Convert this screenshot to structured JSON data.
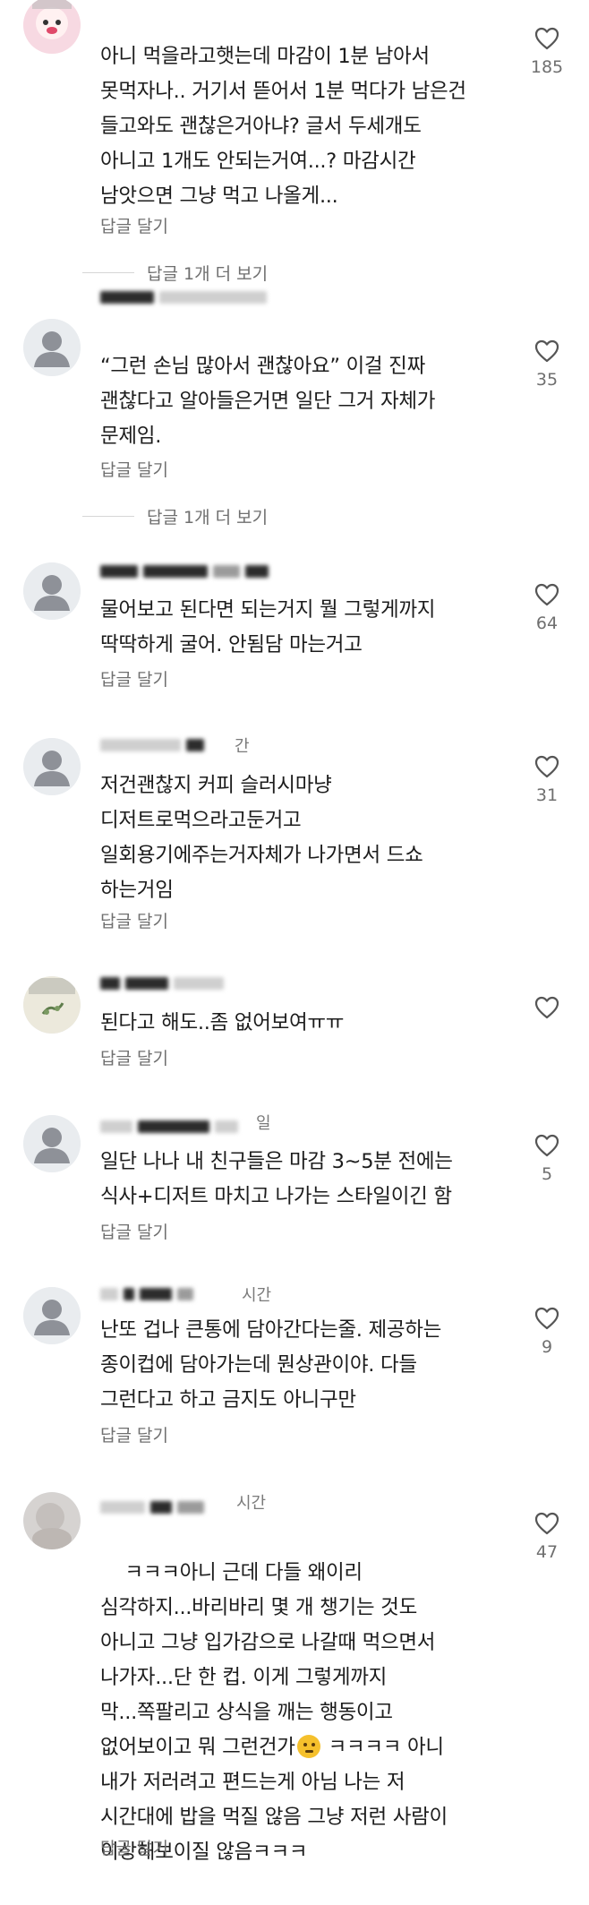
{
  "comments": [
    {
      "text": "아니 먹을라고햇는데 마감이 1분 남아서\n못먹자나.. 거기서 뜯어서 1분 먹다가 남은건\n들고와도 괜찮은거아냐? 글서 두세개도\n아니고 1개도 안되는거여...? 마감시간\n남앗으면 그냥 먹고 나올게...",
      "reply_label": "답글 달기",
      "likes": "185",
      "more_replies": "답글 1개 더 보기"
    },
    {
      "text": "“그런 손님 많아서 괜찮아요” 이걸 진짜\n괜찮다고 알아들은거면 일단 그거 자체가\n문제임.",
      "reply_label": "답글 달기",
      "likes": "35",
      "more_replies": "답글 1개 더 보기"
    },
    {
      "text": "물어보고 된다면 되는거지 뭘 그렇게까지\n딱딱하게 굴어. 안됨담 마는거고",
      "reply_label": "답글 달기",
      "likes": "64"
    },
    {
      "username_suffix": "간",
      "text": "저건괜찮지 커피 슬러시마냥\n디저트로먹으라고둔거고\n일회용기에주는거자체가 나가면서 드쇼\n하는거임",
      "reply_label": "답글 달기",
      "likes": "31"
    },
    {
      "text": "된다고 해도..좀 없어보여ㅠㅠ",
      "reply_label": "답글 달기",
      "likes": ""
    },
    {
      "username_suffix": "일",
      "text": "일단 나나 내 친구들은 마감 3~5분 전에는\n식사+디저트 마치고 나가는 스타일이긴 함",
      "reply_label": "답글 달기",
      "likes": "5"
    },
    {
      "username_suffix": "시간",
      "text": "난또 겁나 큰통에 담아간다는줄. 제공하는\n종이컵에 담아가는데 뭔상관이야. 다들\n그런다고 하고 금지도 아니구만",
      "reply_label": "답글 달기",
      "likes": "9"
    },
    {
      "username_suffix": "시간",
      "text_before_emoji": "ㅋㅋㅋ아니 근데 다들 왜이리\n심각하지...바리바리 몇 개 챙기는 것도\n아니고 그냥 입가감으로 나갈때 먹으면서\n나가자...단 한 컵. 이게 그렇게까지\n막...쪽팔리고 상식을 깨는 행동이고\n없어보이고 뭐 그런건가",
      "text_after_emoji": " ㅋㅋㅋㅋ 아니\n내가 저러려고 편드는게 아님 나는 저\n시간대에 밥을 먹질 않음 그냥 저런 사람이\n이상해보이질 않음ㅋㅋㅋ",
      "emoji": "thinking-face-emoji",
      "reply_label": "답글 달기",
      "likes": "47"
    }
  ],
  "colors": {
    "text": "#1c1c1c",
    "secondary": "#6f6f6f",
    "divider": "#d6d6d6",
    "avatar_gray": "#8e9198"
  }
}
